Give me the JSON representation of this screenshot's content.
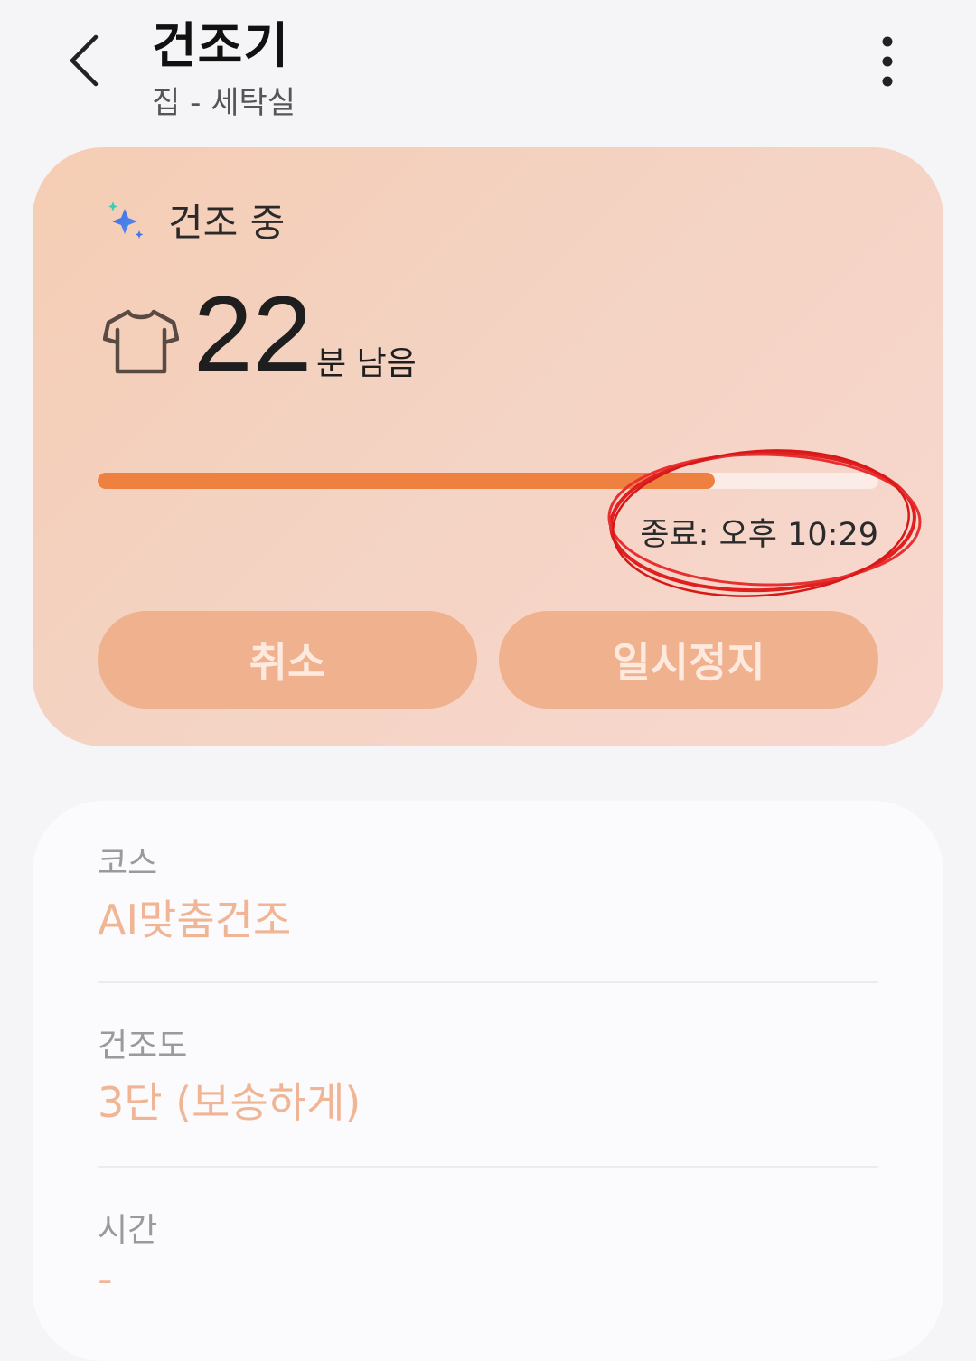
{
  "header": {
    "title": "건조기",
    "subtitle": "집 - 세탁실"
  },
  "status": {
    "state_text": "건조 중",
    "remaining_value": "22",
    "remaining_unit": "분 남음",
    "progress_fraction": 0.79,
    "end_time": "종료: 오후 10:29",
    "cancel_label": "취소",
    "pause_label": "일시정지"
  },
  "details": [
    {
      "label": "코스",
      "value": "AI맞춤건조"
    },
    {
      "label": "건조도",
      "value": "3단 (보송하게)"
    },
    {
      "label": "시간",
      "value": "-"
    }
  ],
  "colors": {
    "progress": "#ee8040",
    "button_bg": "#f0b18e",
    "value_text": "#f0b594",
    "annotation": "#e02020"
  }
}
